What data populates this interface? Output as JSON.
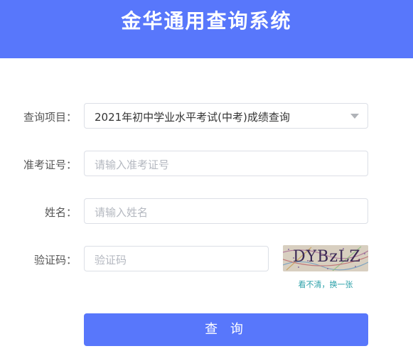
{
  "header": {
    "title": "金华通用查询系统"
  },
  "form": {
    "project": {
      "label": "查询项目：",
      "value": "2021年初中学业水平考试(中考)成绩查询"
    },
    "exam_no": {
      "label": "准考证号：",
      "placeholder": "请输入准考证号"
    },
    "name": {
      "label": "姓名：",
      "placeholder": "请输入姓名"
    },
    "captcha": {
      "label": "验证码：",
      "placeholder": "验证码",
      "image_text": "DYBzLZ",
      "refresh_link": "看不清，换一张"
    },
    "submit_label": "查 询"
  },
  "colors": {
    "primary": "#5877fb",
    "link": "#2aa0a8"
  }
}
